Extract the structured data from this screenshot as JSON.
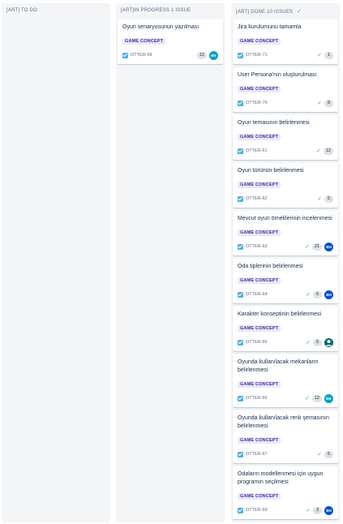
{
  "columns": [
    {
      "title": "[ART] TO DO",
      "done": false,
      "cards": []
    },
    {
      "title": "[ART]IN PROGRESS 1 ISSUE",
      "done": false,
      "cards": [
        {
          "title": "Oyun senaryosunun yazılması",
          "epic": "GAME CONCEPT",
          "key": "OTTER-68",
          "points": "12",
          "done": false,
          "avatar": {
            "kind": "initials",
            "text": "BK",
            "color": "teal"
          }
        }
      ]
    },
    {
      "title": "[ART] DONE 10 ISSUES",
      "done": true,
      "cards": [
        {
          "title": "Jira kurulumunu tamamla",
          "epic": "GAME CONCEPT",
          "key": "OTTER-71",
          "points": "1",
          "done": true,
          "avatar": null
        },
        {
          "title": "User Persona'nın oluşturulması",
          "epic": "GAME CONCEPT",
          "key": "OTTER-79",
          "points": "8",
          "done": true,
          "avatar": null
        },
        {
          "title": "Oyun temasının belirlenmesi",
          "epic": "GAME CONCEPT",
          "key": "OTTER-61",
          "points": "12",
          "done": true,
          "avatar": null
        },
        {
          "title": "Oyun türünün belirlenmesi",
          "epic": "GAME CONCEPT",
          "key": "OTTER-62",
          "points": "5",
          "done": true,
          "avatar": null
        },
        {
          "title": "Mevcut oyun örneklerinin incelenmesi",
          "epic": "GAME CONCEPT",
          "key": "OTTER-63",
          "points": "21",
          "done": true,
          "avatar": {
            "kind": "initials",
            "text": "BH",
            "color": "blue"
          }
        },
        {
          "title": "Oda tiplerinin belirlenmesi",
          "epic": "GAME CONCEPT",
          "key": "OTTER-64",
          "points": "5",
          "done": true,
          "avatar": {
            "kind": "initials",
            "text": "BH",
            "color": "blue"
          }
        },
        {
          "title": "Karakter konseptinin belirlenmesi",
          "epic": "GAME CONCEPT",
          "key": "OTTER-65",
          "points": "5",
          "done": true,
          "avatar": {
            "kind": "person",
            "text": "",
            "color": "dark"
          }
        },
        {
          "title": "Oyunda kullanılacak mekanların belirlenmesi",
          "epic": "GAME CONCEPT",
          "key": "OTTER-66",
          "points": "12",
          "done": true,
          "avatar": {
            "kind": "initials",
            "text": "BK",
            "color": "teal"
          }
        },
        {
          "title": "Oyunda kullanılacak renk şemasının belirlenmesi",
          "epic": "GAME CONCEPT",
          "key": "OTTER-67",
          "points": "5",
          "done": true,
          "avatar": null
        },
        {
          "title": "Odaların modellenmesi için uygun programın seçilmesi",
          "epic": "GAME CONCEPT",
          "key": "OTTER-69",
          "points": "3",
          "done": true,
          "avatar": {
            "kind": "initials",
            "text": "BH",
            "color": "blue"
          }
        }
      ]
    }
  ]
}
